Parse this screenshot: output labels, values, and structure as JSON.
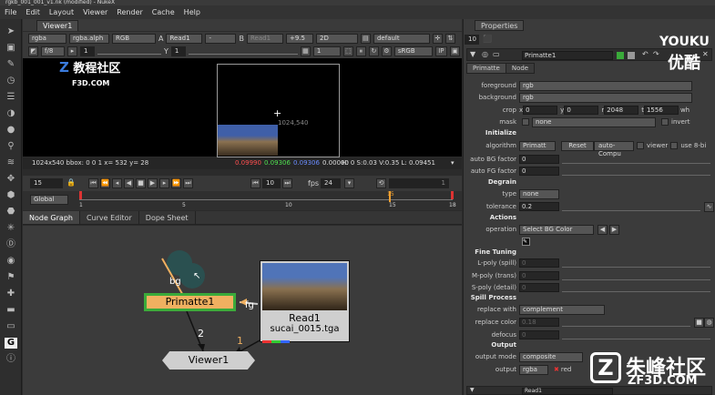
{
  "window": {
    "title": "rgkb_001_001_v1.nk (modified) - NukeX"
  },
  "menu": [
    "File",
    "Edit",
    "Layout",
    "Viewer",
    "Render",
    "Cache",
    "Help"
  ],
  "viewer": {
    "tab": "Viewer1",
    "channels": "rgba",
    "alpha_channel": "rgba.alph",
    "display": "RGB",
    "input_a_label": "A",
    "input_a": "Read1",
    "input_b_mode": "-",
    "input_b_label": "B",
    "input_b": "Read1",
    "zoom": "+9.5",
    "view_mode": "2D",
    "lut": "default",
    "fstop": "f/8",
    "frame_gain": "1",
    "gamma_label": "Y",
    "gamma": "1",
    "proxy": "1",
    "colorspace": "sRGB",
    "ip_label": "IP",
    "format_label": "1024,540",
    "status": {
      "bbox": "1024x540 bbox: 0 0 1  x= 532 y= 28",
      "r": "0.09990",
      "g": "0.09306",
      "b": "0.09306",
      "a": "0.00000",
      "hsvl": "H:  0 S:0.03 V:0.35  L: 0.09451"
    },
    "playback": {
      "frame": "15",
      "step": "10",
      "fps_label": "fps",
      "fps": "24",
      "loop": "1",
      "range_mode": "Global"
    },
    "timeline": {
      "ticks": [
        "1",
        "5",
        "10",
        "15",
        "18"
      ],
      "current": "15"
    }
  },
  "watermark_cn": "教程社区",
  "watermark_site": "F3D.COM",
  "node_graph": {
    "tabs": [
      "Node Graph",
      "Curve Editor",
      "Dope Sheet"
    ],
    "nodes": {
      "primatte": "Primatte1",
      "viewer": "Viewer1",
      "read": "Read1",
      "read_file": "sucai_0015.tga"
    },
    "inputs": {
      "bg": "bg",
      "fg": "fg",
      "in1": "1",
      "in2": "2"
    }
  },
  "properties": {
    "tab": "Properties",
    "max_panels": "10",
    "node_name": "Primatte1",
    "tabs": [
      "Primatte",
      "Node"
    ],
    "foreground": "rgb",
    "background": "rgb",
    "crop": {
      "x": "0",
      "y": "0",
      "r": "2048",
      "t": "1556",
      "wh": "wh"
    },
    "mask": "none",
    "invert_label": "invert",
    "sections": {
      "initialize": "Initialize",
      "degrain": "Degrain",
      "actions": "Actions",
      "fine_tuning": "Fine Tuning",
      "spill": "Spill Process",
      "output": "Output"
    },
    "algorithm": "Primatt",
    "reset_label": "Reset",
    "auto_compute_label": "auto-Compu",
    "viewer_label": "viewer",
    "use_bit_label": "use 8-bi",
    "auto_bg": "0",
    "auto_fg": "0",
    "degrain_type": "none",
    "tolerance": "0.2",
    "operation": "Select BG Color",
    "lpoly": "0",
    "mpoly": "0",
    "spoly": "0",
    "replace_with": "complement",
    "replace_color": "0.18",
    "defocus": "0",
    "output_mode": "composite",
    "output": "rgba",
    "output_red": "red",
    "labels": {
      "foreground": "foreground",
      "background": "background",
      "crop": "crop",
      "mask": "mask",
      "algorithm": "algorithm",
      "auto_bg": "auto BG factor",
      "auto_fg": "auto FG factor",
      "type": "type",
      "tolerance": "tolerance",
      "operation": "operation",
      "lpoly": "L-poly (spill)",
      "mpoly": "M-poly (trans)",
      "spoly": "S-poly (detail)",
      "replace_with": "replace with",
      "replace_color": "replace color",
      "defocus": "defocus",
      "output_mode": "output mode",
      "output": "output"
    },
    "second_node": "Read1"
  },
  "brand": {
    "youku": "YOUKU",
    "youku_cn": "优酷",
    "zf3d_cn": "朱峰社区",
    "zf3d": "ZF3D.COM"
  },
  "colors": {
    "accent_orange": "#f0b060",
    "node_green_border": "#3aaa3a",
    "viewer_node": "#cfcfcf"
  }
}
